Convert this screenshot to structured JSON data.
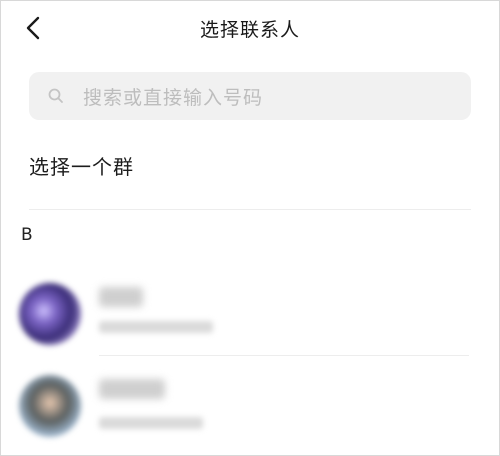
{
  "header": {
    "title": "选择联系人",
    "back_icon": "chevron-left-icon"
  },
  "search": {
    "placeholder": "搜索或直接输入号码",
    "icon": "search-icon"
  },
  "select_group_label": "选择一个群",
  "sections": [
    {
      "letter": "B",
      "contacts": [
        {
          "name": "",
          "subtitle": ""
        },
        {
          "name": "",
          "subtitle": ""
        }
      ]
    }
  ],
  "colors": {
    "search_bg": "#f1f1f1",
    "placeholder": "#bdbdbd",
    "divider": "#ededed"
  }
}
